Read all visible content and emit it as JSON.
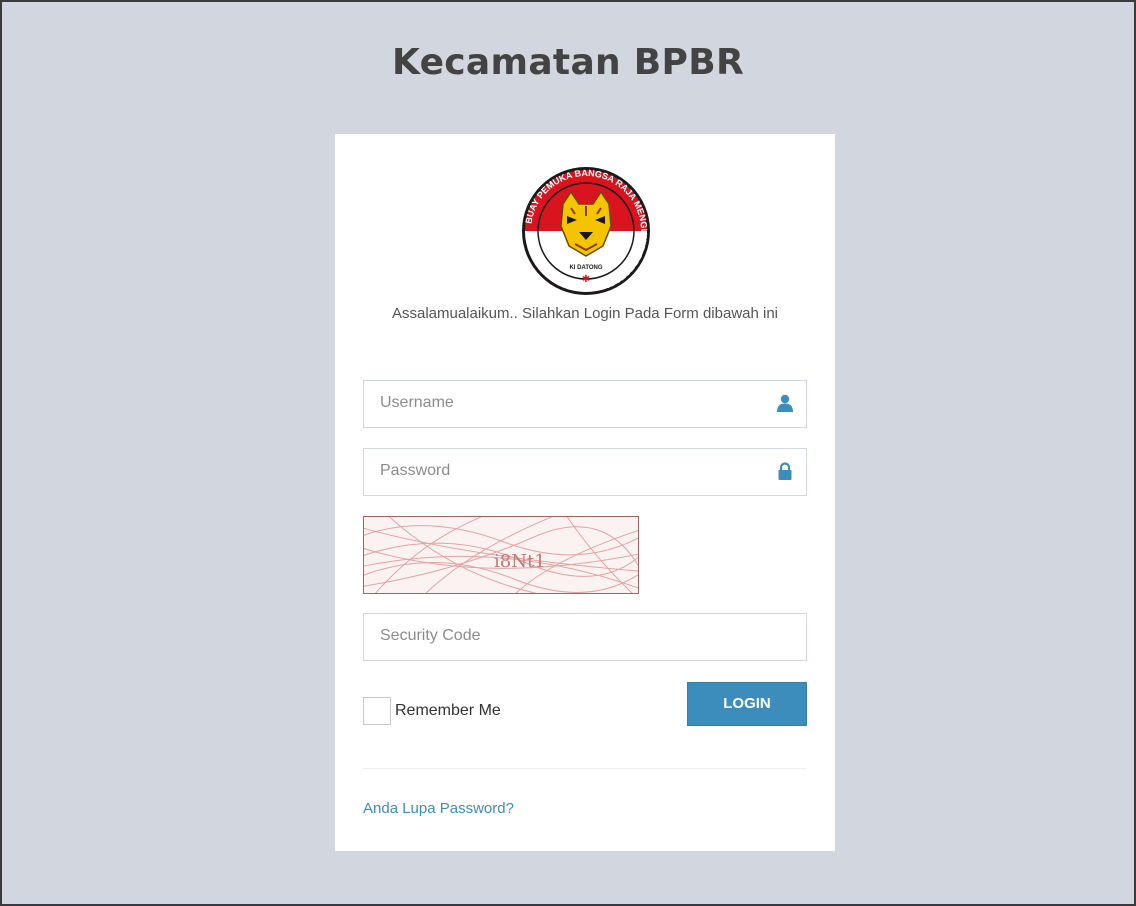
{
  "page": {
    "title": "Kecamatan BPBR"
  },
  "logo": {
    "ring_text": "BUAY PEMUKA BANGSA RAJA MENGUKIR PRESTASI",
    "center_text": "KI DATONG",
    "colors": {
      "ring": "#1a1a1a",
      "top": "#d9141f",
      "bottom": "#ffffff",
      "tiger": "#f5c400"
    }
  },
  "login": {
    "welcome": "Assalamualaikum.. Silahkan Login Pada Form dibawah ini",
    "username": {
      "placeholder": "Username",
      "value": "",
      "icon": "user-icon"
    },
    "password": {
      "placeholder": "Password",
      "value": "",
      "icon": "lock-icon"
    },
    "captcha": {
      "text": "i8Nt1"
    },
    "security_code": {
      "placeholder": "Security Code",
      "value": ""
    },
    "remember_label": "Remember Me",
    "remember_checked": false,
    "submit_label": "LOGIN",
    "forgot_label": "Anda Lupa Password?"
  },
  "colors": {
    "background": "#d1d6df",
    "panel": "#ffffff",
    "primary": "#3c8dbc",
    "title": "#434343"
  }
}
